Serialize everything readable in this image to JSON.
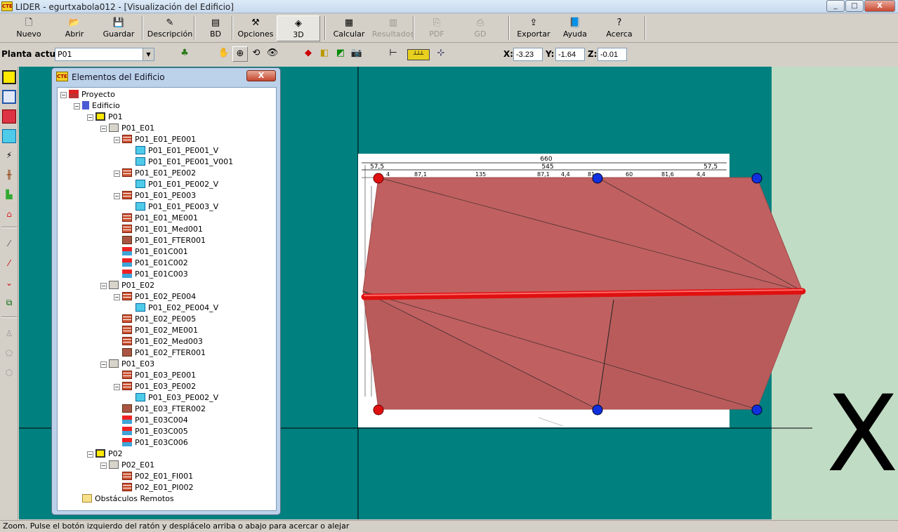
{
  "window": {
    "app_icon": "CTE",
    "title": "LIDER - egurtxabola012 - [Visualización del Edificio]",
    "controls": [
      "_",
      "□",
      "X"
    ]
  },
  "toolbar": [
    {
      "label": "Nuevo",
      "icon": "new-file-icon",
      "glyph": "🗋"
    },
    {
      "label": "Abrir",
      "icon": "open-folder-icon",
      "glyph": "📂"
    },
    {
      "label": "Guardar",
      "icon": "save-disk-icon",
      "glyph": "💾"
    },
    {
      "label": "Descripción",
      "icon": "description-icon",
      "glyph": "✎"
    },
    {
      "label": "BD",
      "icon": "database-icon",
      "glyph": "▤"
    },
    {
      "label": "Opciones",
      "icon": "hammer-icon",
      "glyph": "⚒"
    },
    {
      "label": "3D",
      "icon": "3d-icon",
      "glyph": "◈"
    },
    {
      "label": "Calcular",
      "icon": "calculator-icon",
      "glyph": "▦"
    },
    {
      "label": "Resultados",
      "icon": "chart-icon",
      "glyph": "▥"
    },
    {
      "label": "PDF",
      "icon": "pdf-icon",
      "glyph": "⎘"
    },
    {
      "label": "GD",
      "icon": "gd-icon",
      "glyph": "⎙"
    },
    {
      "label": "Exportar",
      "icon": "export-icon",
      "glyph": "⇪"
    },
    {
      "label": "Ayuda",
      "icon": "help-book-icon",
      "glyph": "📘"
    },
    {
      "label": "Acerca",
      "icon": "question-icon",
      "glyph": "?"
    }
  ],
  "toolbar2": {
    "planta_label": "Planta actual",
    "planta_value": "P01",
    "x_label": "X:",
    "x_value": "-3.23",
    "y_label": "Y:",
    "y_value": "-1.64",
    "z_label": "Z:",
    "z_value": "-0.01"
  },
  "panel": {
    "app_icon": "CTE",
    "title": "Elementos del Edificio",
    "close": "X"
  },
  "tree": [
    {
      "label": "Proyecto",
      "icon": "proy"
    },
    {
      "label": "Edificio",
      "icon": "edif"
    },
    {
      "label": "P01",
      "icon": "plan"
    },
    {
      "label": "P01_E01",
      "icon": "esp"
    },
    {
      "label": "P01_E01_PE001",
      "icon": "wall"
    },
    {
      "label": "P01_E01_PE001_V",
      "icon": "win"
    },
    {
      "label": "P01_E01_PE001_V001",
      "icon": "win"
    },
    {
      "label": "P01_E01_PE002",
      "icon": "wall"
    },
    {
      "label": "P01_E01_PE002_V",
      "icon": "win"
    },
    {
      "label": "P01_E01_PE003",
      "icon": "wall"
    },
    {
      "label": "P01_E01_PE003_V",
      "icon": "win"
    },
    {
      "label": "P01_E01_ME001",
      "icon": "wall"
    },
    {
      "label": "P01_E01_Med001",
      "icon": "wall"
    },
    {
      "label": "P01_E01_FTER001",
      "icon": "frame"
    },
    {
      "label": "P01_E01C001",
      "icon": "roof"
    },
    {
      "label": "P01_E01C002",
      "icon": "roof"
    },
    {
      "label": "P01_E01C003",
      "icon": "roof"
    },
    {
      "label": "P01_E02",
      "icon": "esp"
    },
    {
      "label": "P01_E02_PE004",
      "icon": "wall"
    },
    {
      "label": "P01_E02_PE004_V",
      "icon": "win"
    },
    {
      "label": "P01_E02_PE005",
      "icon": "wall"
    },
    {
      "label": "P01_E02_ME001",
      "icon": "wall"
    },
    {
      "label": "P01_E02_Med003",
      "icon": "wall"
    },
    {
      "label": "P01_E02_FTER001",
      "icon": "frame"
    },
    {
      "label": "P01_E03",
      "icon": "esp"
    },
    {
      "label": "P01_E03_PE001",
      "icon": "wall"
    },
    {
      "label": "P01_E03_PE002",
      "icon": "wall"
    },
    {
      "label": "P01_E03_PE002_V",
      "icon": "win"
    },
    {
      "label": "P01_E03_FTER002",
      "icon": "frame"
    },
    {
      "label": "P01_E03C004",
      "icon": "roof"
    },
    {
      "label": "P01_E03C005",
      "icon": "roof"
    },
    {
      "label": "P01_E03C006",
      "icon": "roof"
    },
    {
      "label": "P02",
      "icon": "plan"
    },
    {
      "label": "P02_E01",
      "icon": "esp"
    },
    {
      "label": "P02_E01_FI001",
      "icon": "wall"
    },
    {
      "label": "P02_E01_PI002",
      "icon": "wall"
    },
    {
      "label": "Obstáculos Remotos",
      "icon": "fold"
    }
  ],
  "plan_dims": {
    "total": "660",
    "sub": "545",
    "left": "57,5",
    "right": "57,5",
    "row": [
      "4",
      "87,1",
      "135",
      "87,1",
      "4,4",
      "81",
      "60",
      "81,6",
      "4,4"
    ]
  },
  "axis_marker": "X",
  "status": "Zoom. Pulse el botón izquierdo del ratón y desplácelo arriba o abajo para acercar o alejar",
  "colors": {
    "viewport": "#018080",
    "right_panel": "#c1dcc4",
    "building": "#c06060",
    "edge_red": "#e01010",
    "vertex_blue": "#1030e0"
  }
}
